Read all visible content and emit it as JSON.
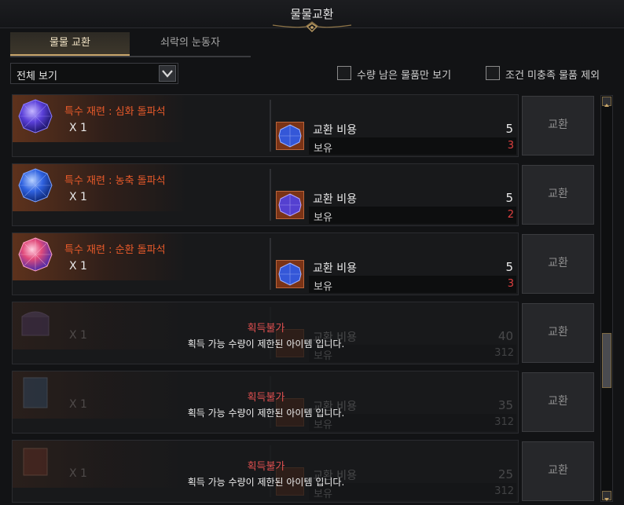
{
  "window": {
    "title": "물물교환"
  },
  "tabs": [
    {
      "label": "물물 교환",
      "active": true
    },
    {
      "label": "쇠락의 눈동자",
      "active": false
    }
  ],
  "filter": {
    "selected": "전체 보기"
  },
  "checks": [
    {
      "label": "수량 남은 물품만 보기",
      "checked": false
    },
    {
      "label": "조건 미충족 물품 제외",
      "checked": false
    }
  ],
  "rows": [
    {
      "name": "특수 재련 : 심화 돌파석",
      "qty": "X 1",
      "icon": "blue-purple-gem-icon",
      "cost_label": "교환 비용",
      "cost": "5",
      "own_label": "보유",
      "own": "3",
      "button": "교환"
    },
    {
      "name": "특수 재련 : 농축 돌파석",
      "qty": "X 1",
      "icon": "blue-gem-icon",
      "cost_label": "교환 비용",
      "cost": "5",
      "own_label": "보유",
      "own": "2",
      "button": "교환"
    },
    {
      "name": "특수 재련 : 순환 돌파석",
      "qty": "X 1",
      "icon": "pink-gem-icon",
      "cost_label": "교환 비용",
      "cost": "5",
      "own_label": "보유",
      "own": "3",
      "button": "교환"
    },
    {
      "name": "",
      "qty": "X 1",
      "icon": "chest-icon",
      "cost_label": "교환 비용",
      "cost": "40",
      "own_label": "보유",
      "own": "312",
      "button": "교환",
      "lock_title": "획득불가",
      "lock_desc": "획득 가능 수량이 제한된 아이템 입니다."
    },
    {
      "name": "",
      "qty": "X 1",
      "icon": "card-pack-icon",
      "cost_label": "교환 비용",
      "cost": "35",
      "own_label": "보유",
      "own": "312",
      "button": "교환",
      "lock_title": "획득불가",
      "lock_desc": "획득 가능 수량이 제한된 아이템 입니다."
    },
    {
      "name": "",
      "qty": "X 1",
      "icon": "book-icon",
      "cost_label": "교환 비용",
      "cost": "25",
      "own_label": "보유",
      "own": "312",
      "button": "교환",
      "lock_title": "획득불가",
      "lock_desc": "획득 가능 수량이 제한된 아이템 입니다."
    }
  ],
  "scroll": {
    "position": 0.6
  }
}
